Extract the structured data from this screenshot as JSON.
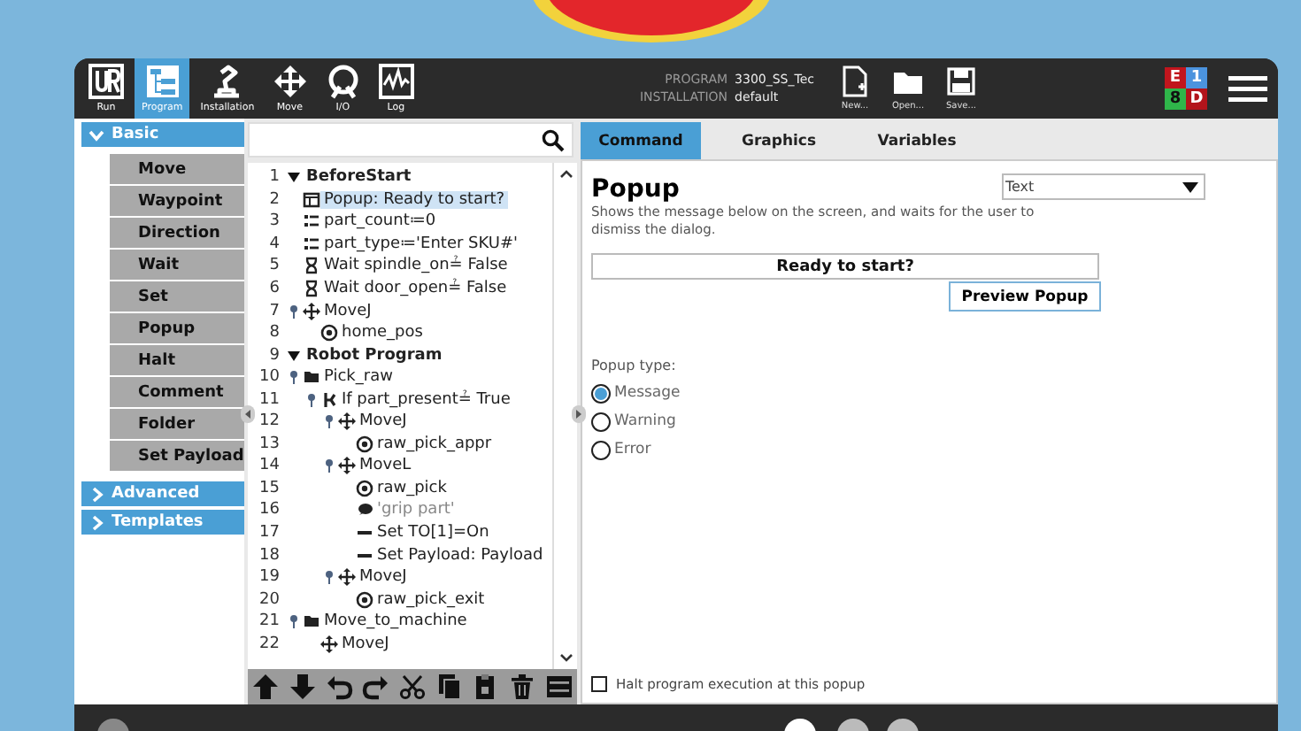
{
  "header": {
    "nav": [
      {
        "label": "Run",
        "kind": "run",
        "selected": false
      },
      {
        "label": "Program",
        "kind": "program",
        "selected": true
      },
      {
        "label": "Installation",
        "kind": "installation",
        "selected": false
      },
      {
        "label": "Move",
        "kind": "move",
        "selected": false
      },
      {
        "label": "I/O",
        "kind": "io",
        "selected": false
      },
      {
        "label": "Log",
        "kind": "log",
        "selected": false
      }
    ],
    "program_label": "PROGRAM",
    "program_name": "3300_SS_Tec",
    "installation_label": "INSTALLATION",
    "installation_name": "default",
    "file_actions": [
      {
        "label": "New...",
        "kind": "new"
      },
      {
        "label": "Open...",
        "kind": "open"
      },
      {
        "label": "Save...",
        "kind": "save"
      }
    ],
    "status": [
      {
        "label": "E",
        "color": "#c1151d"
      },
      {
        "label": "1",
        "color": "#4b93de"
      },
      {
        "label": "8",
        "color": "#2fb54a"
      },
      {
        "label": "D",
        "color": "#b3141b"
      }
    ]
  },
  "categories": [
    {
      "label": "Basic",
      "expanded": true,
      "items": [
        "Move",
        "Waypoint",
        "Direction",
        "Wait",
        "Set",
        "Popup",
        "Halt",
        "Comment",
        "Folder",
        "Set Payload"
      ]
    },
    {
      "label": "Advanced",
      "expanded": false
    },
    {
      "label": "Templates",
      "expanded": false
    }
  ],
  "tree": [
    {
      "line": "1",
      "label": "BeforeStart",
      "kind": "section",
      "selected": false,
      "children": [
        {
          "line": "2",
          "label": "Popup: Ready to start?",
          "kind": "popup",
          "selected": true
        },
        {
          "line": "3",
          "label": "part_count≔0",
          "kind": "assign",
          "selected": false
        },
        {
          "line": "4",
          "label": "part_type≔'Enter SKU#'",
          "kind": "assign",
          "selected": false
        },
        {
          "line": "5",
          "label": "Wait spindle_on≟ False",
          "kind": "wait",
          "selected": false
        },
        {
          "line": "6",
          "label": "Wait door_open≟ False",
          "kind": "wait",
          "selected": false
        },
        {
          "line": "7",
          "label": "MoveJ",
          "kind": "move",
          "selected": false,
          "children": [
            {
              "line": "8",
              "label": "home_pos",
              "kind": "waypoint",
              "selected": false
            }
          ]
        }
      ]
    },
    {
      "line": "9",
      "label": "Robot Program",
      "kind": "section",
      "selected": false,
      "children": [
        {
          "line": "10",
          "label": "Pick_raw",
          "kind": "folder",
          "selected": false,
          "children": [
            {
              "line": "11",
              "label": "If part_present≟ True",
              "kind": "if",
              "selected": false,
              "children": [
                {
                  "line": "12",
                  "label": "MoveJ",
                  "kind": "move",
                  "selected": false,
                  "children": [
                    {
                      "line": "13",
                      "label": "raw_pick_appr",
                      "kind": "waypoint",
                      "selected": false
                    }
                  ]
                },
                {
                  "line": "14",
                  "label": "MoveL",
                  "kind": "move",
                  "selected": false,
                  "children": [
                    {
                      "line": "15",
                      "label": "raw_pick",
                      "kind": "waypoint",
                      "selected": false
                    },
                    {
                      "line": "16",
                      "label": "'grip part'",
                      "kind": "comment",
                      "selected": false
                    },
                    {
                      "line": "17",
                      "label": "Set TO[1]=On",
                      "kind": "set",
                      "selected": false
                    },
                    {
                      "line": "18",
                      "label": "Set Payload: Payload",
                      "kind": "set",
                      "selected": false
                    }
                  ]
                },
                {
                  "line": "19",
                  "label": "MoveJ",
                  "kind": "move",
                  "selected": false,
                  "children": [
                    {
                      "line": "20",
                      "label": "raw_pick_exit",
                      "kind": "waypoint",
                      "selected": false
                    }
                  ]
                }
              ]
            }
          ]
        },
        {
          "line": "21",
          "label": "Move_to_machine",
          "kind": "folder",
          "selected": false,
          "children": [
            {
              "line": "22",
              "label": "MoveJ",
              "kind": "move",
              "selected": false
            }
          ]
        }
      ]
    }
  ],
  "command": {
    "tabs": [
      {
        "label": "Command",
        "selected": true
      },
      {
        "label": "Graphics",
        "selected": false
      },
      {
        "label": "Variables",
        "selected": false
      }
    ],
    "title": "Popup",
    "type_select": "Text",
    "description": "Shows the message below on the screen, and waits for the user to dismiss the dialog.",
    "message": "Ready to start?",
    "preview_button": "Preview Popup",
    "popup_type_label": "Popup type:",
    "popup_types": [
      {
        "label": "Message",
        "selected": true
      },
      {
        "label": "Warning",
        "selected": false
      },
      {
        "label": "Error",
        "selected": false
      }
    ],
    "halt": {
      "label": "Halt program execution at this popup",
      "checked": false
    }
  }
}
